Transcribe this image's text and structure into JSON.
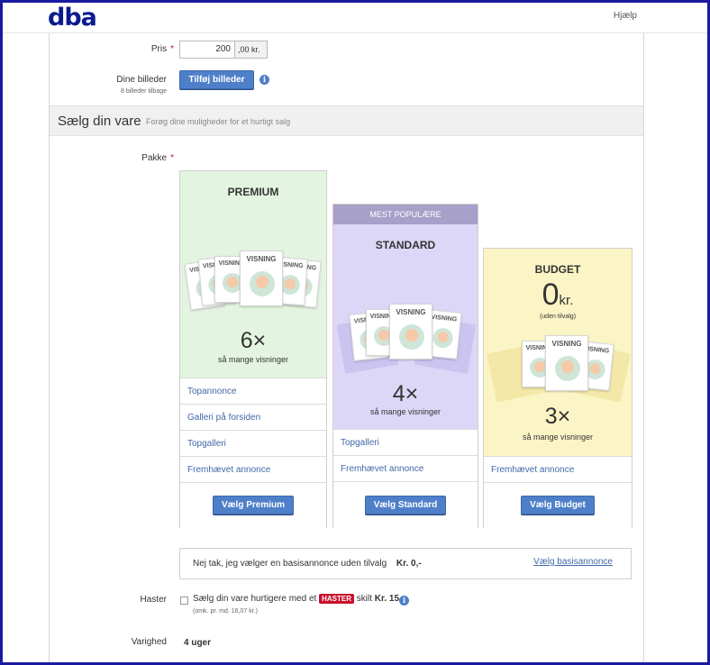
{
  "header": {
    "logo": "dba",
    "help_label": "Hjælp"
  },
  "form": {
    "price_label": "Pris",
    "price_value": "200",
    "price_suffix": ",00 kr.",
    "images_label": "Dine billeder",
    "images_sub": "8 billeder tilbage",
    "add_images_label": "Tilføj billeder",
    "info_glyph": "i",
    "required_glyph": "*"
  },
  "section": {
    "title": "Sælg din vare",
    "subtitle": "Forøg dine muligheder for et hurtigt salg"
  },
  "package_label": "Pakke",
  "packages": {
    "premium": {
      "name": "PREMIUM",
      "multiplier": "6×",
      "multiplier_sub": "så mange visninger",
      "card_label": "VISNING",
      "features": [
        "Topannonce",
        "Galleri på forsiden",
        "Topgalleri",
        "Fremhævet annonce"
      ],
      "button": "Vælg Premium",
      "bg_color": "#e3f5e0"
    },
    "standard": {
      "ribbon": "MEST POPULÆRE",
      "name": "STANDARD",
      "multiplier": "4×",
      "multiplier_sub": "så mange visninger",
      "card_label": "VISNING",
      "features": [
        "Topgalleri",
        "Fremhævet annonce"
      ],
      "button": "Vælg Standard",
      "bg_color": "#ddd7f7"
    },
    "budget": {
      "name": "BUDGET",
      "price_big": "0",
      "price_unit": "kr.",
      "price_sub": "(uden tilvalg)",
      "multiplier": "3×",
      "multiplier_sub": "så mange visninger",
      "card_label": "VISNING",
      "features": [
        "Fremhævet annonce"
      ],
      "button": "Vælg Budget",
      "bg_color": "#fbf5c6"
    }
  },
  "basis": {
    "text": "Nej tak, jeg vælger en basisannonce uden tilvalg",
    "price": "Kr. 0,-",
    "link": "Vælg basisannonce"
  },
  "haster": {
    "label": "Haster",
    "text_before": "Sælg din vare hurtigere med et",
    "badge": "HASTER",
    "text_after": "skilt",
    "price": "Kr. 15,-",
    "sub": "(omk. pr. md. 16,07 kr.)"
  },
  "duration": {
    "label": "Varighed",
    "value": "4 uger"
  },
  "colors": {
    "accent": "#4e7fc9",
    "brand": "#0b1b8f",
    "link": "#4268a8",
    "danger": "#c8102e",
    "ribbon": "#a7a0c9"
  }
}
